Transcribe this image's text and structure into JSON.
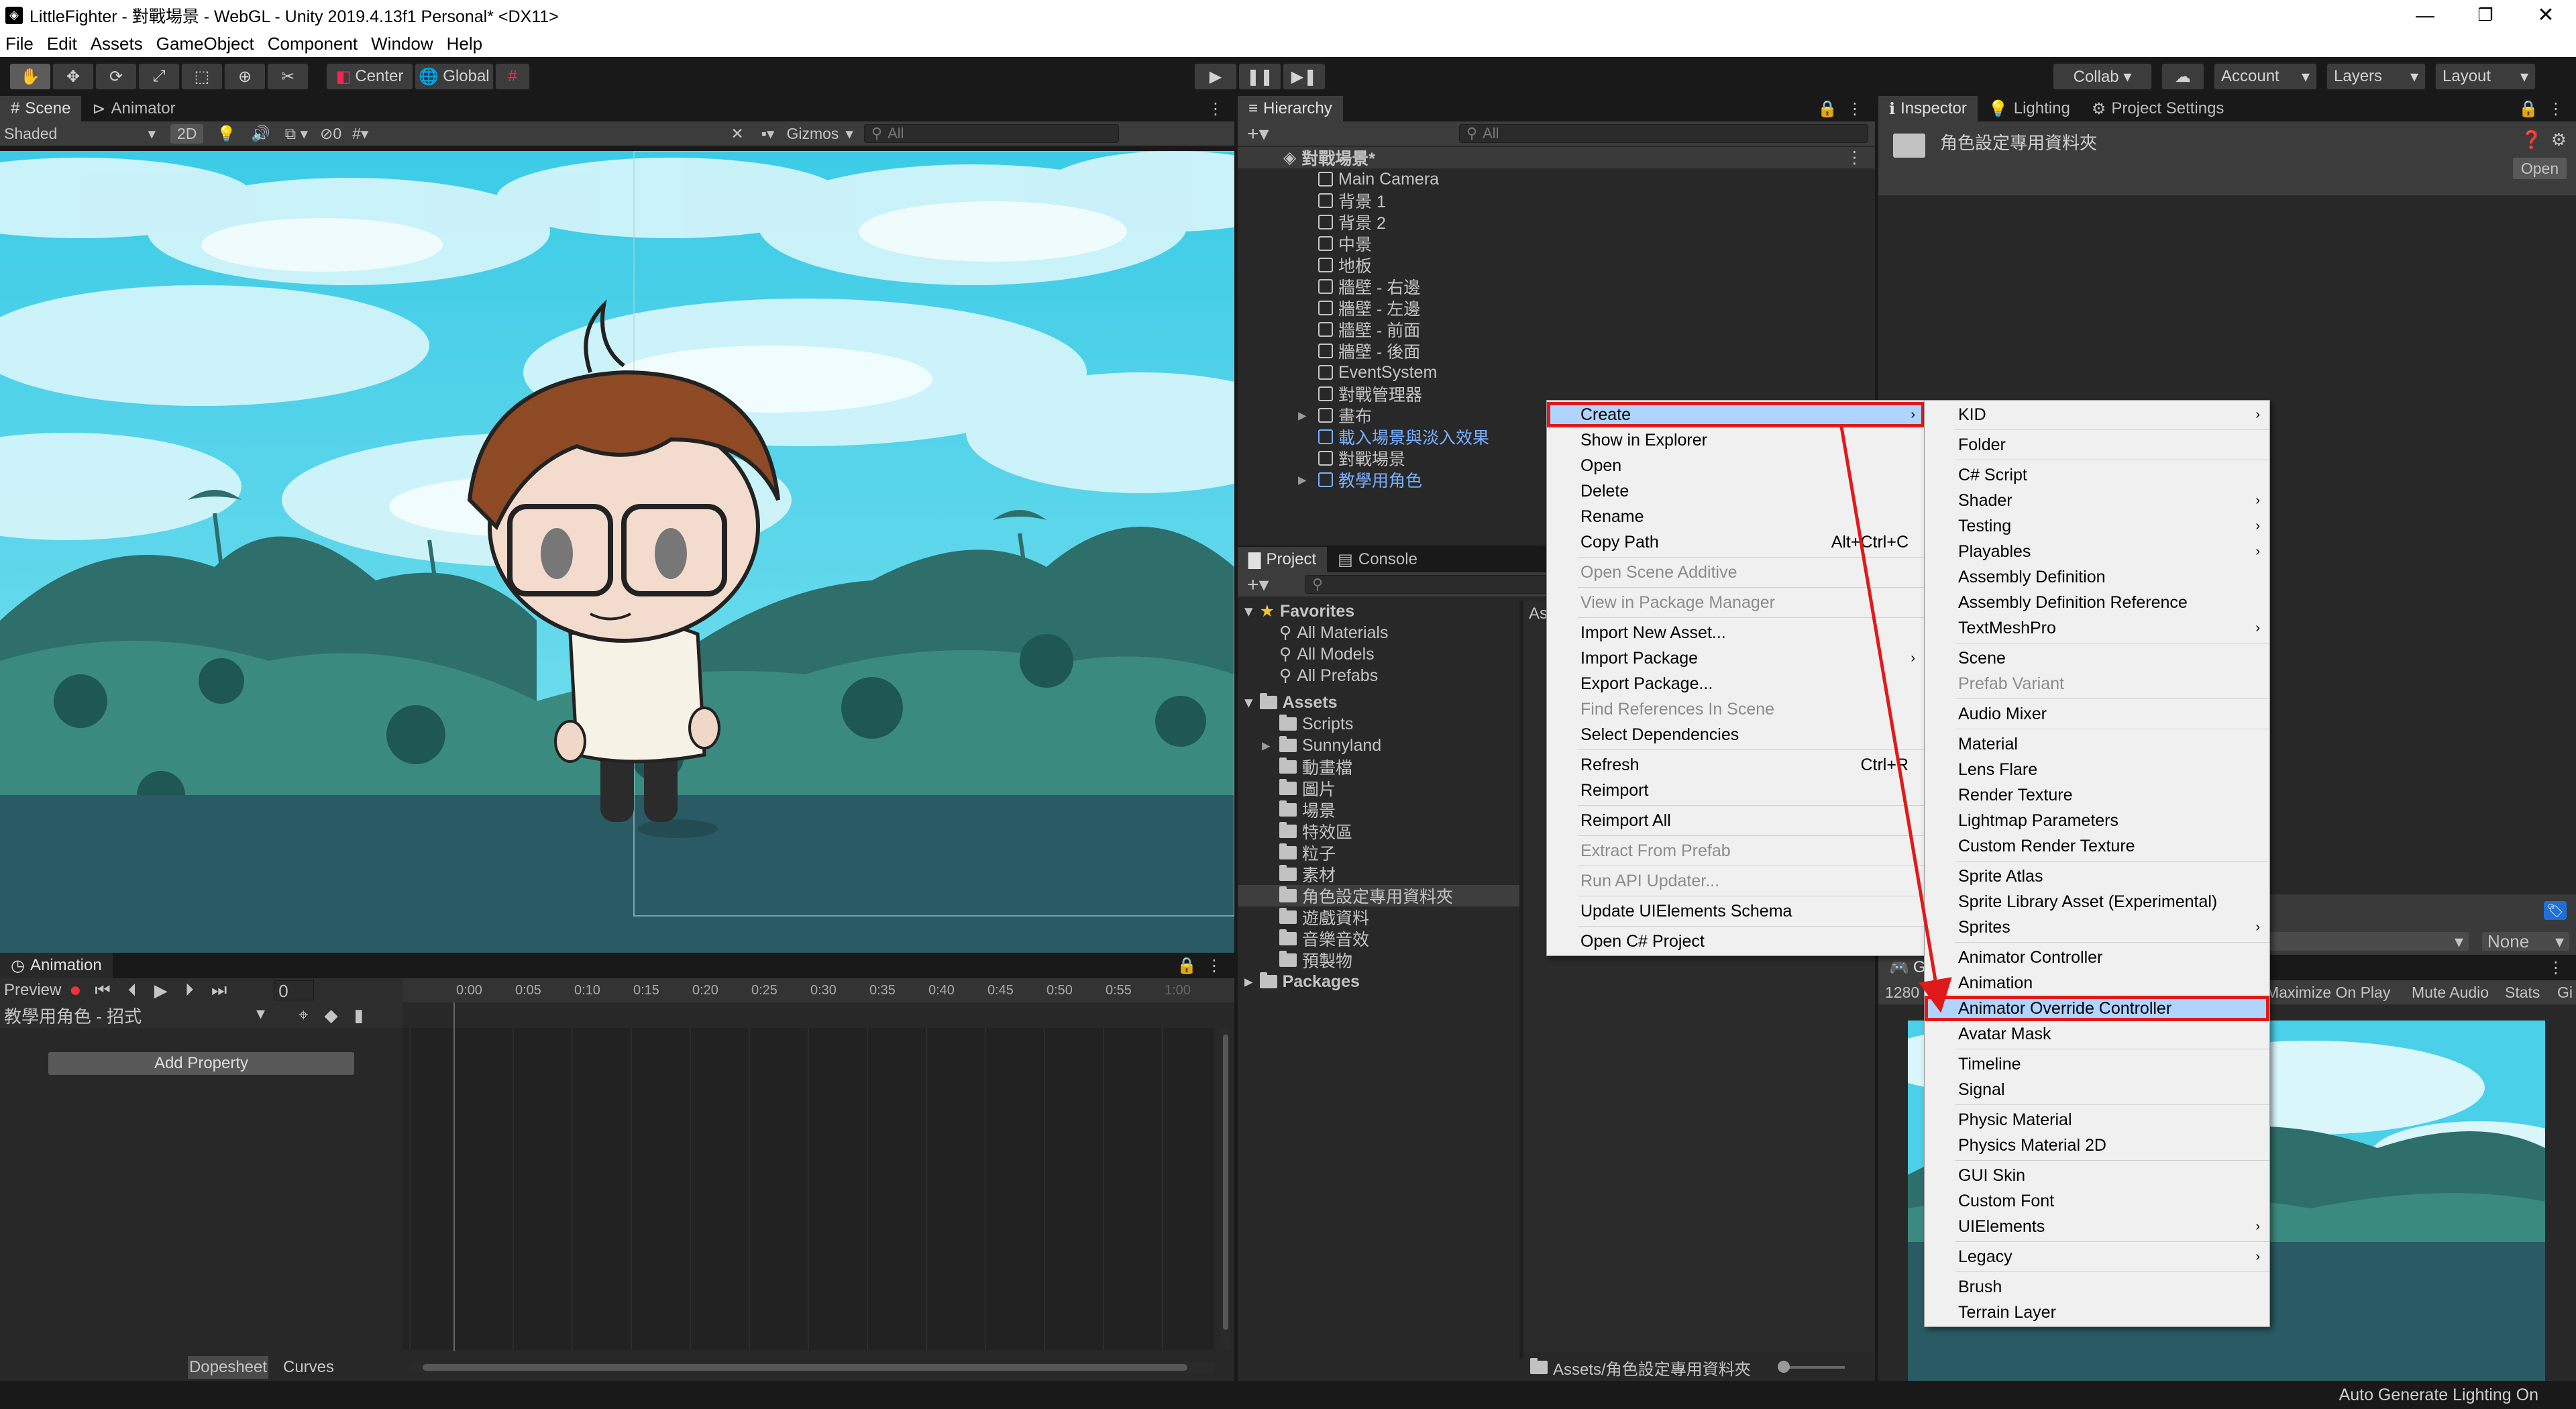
{
  "window": {
    "title": "LittleFighter - 對戰場景 - WebGL - Unity 2019.4.13f1 Personal* <DX11>"
  },
  "menu": [
    "File",
    "Edit",
    "Assets",
    "GameObject",
    "Component",
    "Window",
    "Help"
  ],
  "toolbar": {
    "center": "Center",
    "global": "Global",
    "collab": "Collab ▾",
    "account": "Account",
    "layers": "Layers",
    "layout": "Layout"
  },
  "scene": {
    "tab_scene": "Scene",
    "tab_animator": "Animator",
    "shading": "Shaded",
    "mode_2d": "2D",
    "fx_count": "0",
    "gizmos": "Gizmos",
    "search_placeholder": "All"
  },
  "animation": {
    "tab": "Animation",
    "preview": "Preview",
    "frame": "0",
    "clip": "教學用角色 - 招式",
    "add_property": "Add Property",
    "ticks": [
      "0:00",
      "0:05",
      "0:10",
      "0:15",
      "0:20",
      "0:25",
      "0:30",
      "0:35",
      "0:40",
      "0:45",
      "0:50",
      "0:55",
      "1:00"
    ],
    "dopesheet": "Dopesheet",
    "curves": "Curves"
  },
  "hierarchy": {
    "tab": "Hierarchy",
    "search_placeholder": "All",
    "scene_name": "對戰場景*",
    "items": [
      {
        "label": "Main Camera",
        "blue": false,
        "arrow": false
      },
      {
        "label": "背景 1",
        "blue": false,
        "arrow": false
      },
      {
        "label": "背景 2",
        "blue": false,
        "arrow": false
      },
      {
        "label": "中景",
        "blue": false,
        "arrow": false
      },
      {
        "label": "地板",
        "blue": false,
        "arrow": false
      },
      {
        "label": "牆壁 - 右邊",
        "blue": false,
        "arrow": false
      },
      {
        "label": "牆壁 - 左邊",
        "blue": false,
        "arrow": false
      },
      {
        "label": "牆壁 - 前面",
        "blue": false,
        "arrow": false
      },
      {
        "label": "牆壁 - 後面",
        "blue": false,
        "arrow": false
      },
      {
        "label": "EventSystem",
        "blue": false,
        "arrow": false
      },
      {
        "label": "對戰管理器",
        "blue": false,
        "arrow": false
      },
      {
        "label": "畫布",
        "blue": false,
        "arrow": true
      },
      {
        "label": "載入場景與淡入效果",
        "blue": true,
        "arrow": false
      },
      {
        "label": "對戰場景",
        "blue": false,
        "arrow": false
      },
      {
        "label": "教學用角色",
        "blue": true,
        "arrow": true
      }
    ]
  },
  "project": {
    "tab_project": "Project",
    "tab_console": "Console",
    "favorites": "Favorites",
    "fav_items": [
      "All Materials",
      "All Models",
      "All Prefabs"
    ],
    "assets": "Assets",
    "asset_folders": [
      "Scripts",
      "Sunnyland",
      "動畫檔",
      "圖片",
      "場景",
      "特效區",
      "粒子",
      "素材",
      "角色設定專用資料夾",
      "遊戲資料",
      "音樂音效",
      "預製物"
    ],
    "packages": "Packages",
    "path": "Assets/角色設定專用資料夾",
    "breadcrumb": "Ass"
  },
  "inspector": {
    "tabs": [
      "Inspector",
      "Lighting",
      "Project Settings"
    ],
    "folder_name": "角色設定專用資料夾",
    "open": "Open",
    "none": "None"
  },
  "game": {
    "resolution": "1280",
    "maximize": "Maximize On Play",
    "mute": "Mute Audio",
    "stats": "Stats",
    "gi": "Gi",
    "tab_fragment": "G"
  },
  "context_menu": [
    {
      "label": "Create",
      "arrow": true,
      "highlight": true
    },
    {
      "label": "Show in Explorer"
    },
    {
      "label": "Open"
    },
    {
      "label": "Delete"
    },
    {
      "label": "Rename"
    },
    {
      "label": "Copy Path",
      "shortcut": "Alt+Ctrl+C"
    },
    {
      "sep": true
    },
    {
      "label": "Open Scene Additive",
      "disabled": true
    },
    {
      "sep": true
    },
    {
      "label": "View in Package Manager",
      "disabled": true
    },
    {
      "sep": true
    },
    {
      "label": "Import New Asset..."
    },
    {
      "label": "Import Package",
      "arrow": true
    },
    {
      "label": "Export Package..."
    },
    {
      "label": "Find References In Scene",
      "disabled": true
    },
    {
      "label": "Select Dependencies"
    },
    {
      "sep": true
    },
    {
      "label": "Refresh",
      "shortcut": "Ctrl+R"
    },
    {
      "label": "Reimport"
    },
    {
      "sep": true
    },
    {
      "label": "Reimport All"
    },
    {
      "sep": true
    },
    {
      "label": "Extract From Prefab",
      "disabled": true
    },
    {
      "sep": true
    },
    {
      "label": "Run API Updater...",
      "disabled": true
    },
    {
      "sep": true
    },
    {
      "label": "Update UIElements Schema"
    },
    {
      "sep": true
    },
    {
      "label": "Open C# Project"
    }
  ],
  "create_menu": [
    {
      "label": "KID",
      "arrow": true
    },
    {
      "sep": true
    },
    {
      "label": "Folder"
    },
    {
      "sep": true
    },
    {
      "label": "C# Script"
    },
    {
      "label": "Shader",
      "arrow": true
    },
    {
      "label": "Testing",
      "arrow": true
    },
    {
      "label": "Playables",
      "arrow": true
    },
    {
      "label": "Assembly Definition"
    },
    {
      "label": "Assembly Definition Reference"
    },
    {
      "label": "TextMeshPro",
      "arrow": true
    },
    {
      "sep": true
    },
    {
      "label": "Scene"
    },
    {
      "label": "Prefab Variant",
      "disabled": true
    },
    {
      "sep": true
    },
    {
      "label": "Audio Mixer"
    },
    {
      "sep": true
    },
    {
      "label": "Material"
    },
    {
      "label": "Lens Flare"
    },
    {
      "label": "Render Texture"
    },
    {
      "label": "Lightmap Parameters"
    },
    {
      "label": "Custom Render Texture"
    },
    {
      "sep": true
    },
    {
      "label": "Sprite Atlas"
    },
    {
      "label": "Sprite Library Asset (Experimental)"
    },
    {
      "label": "Sprites",
      "arrow": true
    },
    {
      "sep": true
    },
    {
      "label": "Animator Controller"
    },
    {
      "label": "Animation"
    },
    {
      "label": "Animator Override Controller",
      "highlight": true
    },
    {
      "label": "Avatar Mask"
    },
    {
      "sep": true
    },
    {
      "label": "Timeline"
    },
    {
      "label": "Signal"
    },
    {
      "sep": true
    },
    {
      "label": "Physic Material"
    },
    {
      "label": "Physics Material 2D"
    },
    {
      "sep": true
    },
    {
      "label": "GUI Skin"
    },
    {
      "label": "Custom Font"
    },
    {
      "label": "UIElements",
      "arrow": true
    },
    {
      "sep": true
    },
    {
      "label": "Legacy",
      "arrow": true
    },
    {
      "sep": true
    },
    {
      "label": "Brush"
    },
    {
      "label": "Terrain Layer"
    }
  ],
  "status": {
    "text": "Auto Generate Lighting On"
  }
}
